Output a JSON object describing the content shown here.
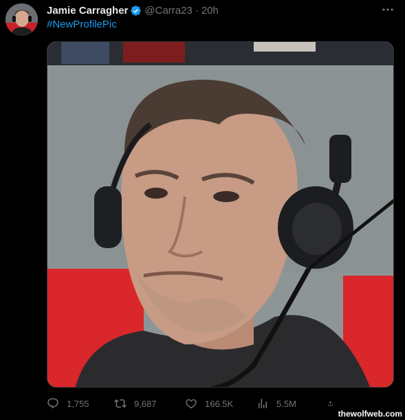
{
  "tweet": {
    "author": {
      "name": "Jamie Carragher",
      "handle": "@Carra23",
      "separator": "·",
      "time": "20h",
      "verified": true
    },
    "text": "#NewProfilePic",
    "media": {
      "description_icon": "photo"
    },
    "actions": {
      "replies": "1,755",
      "retweets": "9,687",
      "likes": "166.5K",
      "views": "5.5M"
    },
    "more_icon": "more-horizontal-icon"
  },
  "watermark": "thewolfweb.com",
  "colors": {
    "background": "#000000",
    "text": "#e7e9ea",
    "muted": "#71767b",
    "link": "#1d9bf0",
    "verified": "#1d9bf0"
  }
}
